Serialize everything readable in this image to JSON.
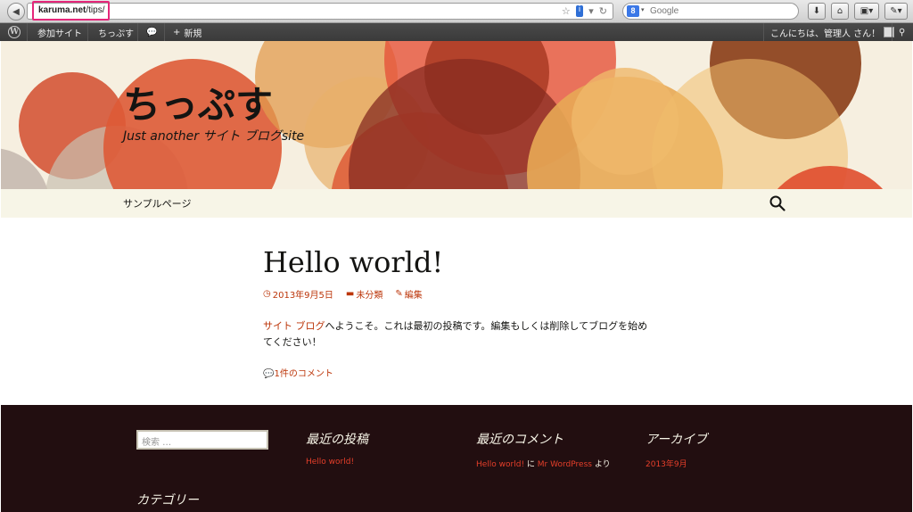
{
  "browser": {
    "url_host": "karuma.net",
    "url_path": "/tips/",
    "search_engine_badge": "8",
    "search_placeholder": "Google"
  },
  "adminbar": {
    "visit_site": "参加サイト",
    "site_name": "ちっぷす",
    "new_label": "新規",
    "greeting": "こんにちは、管理人 さん！"
  },
  "site": {
    "title": "ちっぷす",
    "description": "Just another サイト ブログsite"
  },
  "nav": {
    "items": [
      {
        "label": "サンプルページ"
      }
    ]
  },
  "post": {
    "title": "Hello world!",
    "date": "2013年9月5日",
    "category": "未分類",
    "edit": "編集",
    "body_link": "サイト ブログ",
    "body_text": "へようこそ。これは最初の投稿です。編集もしくは削除してブログを始めてください！",
    "comments": "1件のコメント"
  },
  "footer": {
    "search_placeholder": "検索 …",
    "recent_posts_title": "最近の投稿",
    "recent_post_link": "Hello world!",
    "recent_comments_title": "最近のコメント",
    "recent_comment_post": "Hello world!",
    "recent_comment_mid": " に ",
    "recent_comment_author": "Mr WordPress",
    "recent_comment_suffix": " より",
    "archives_title": "アーカイブ",
    "archive_link": "2013年9月",
    "categories_title": "カテゴリー"
  },
  "colors": {
    "accent": "#bc360a",
    "footer_bg": "#220e10",
    "nav_bg": "#f7f5e7",
    "url_highlight": "#e5277a"
  }
}
